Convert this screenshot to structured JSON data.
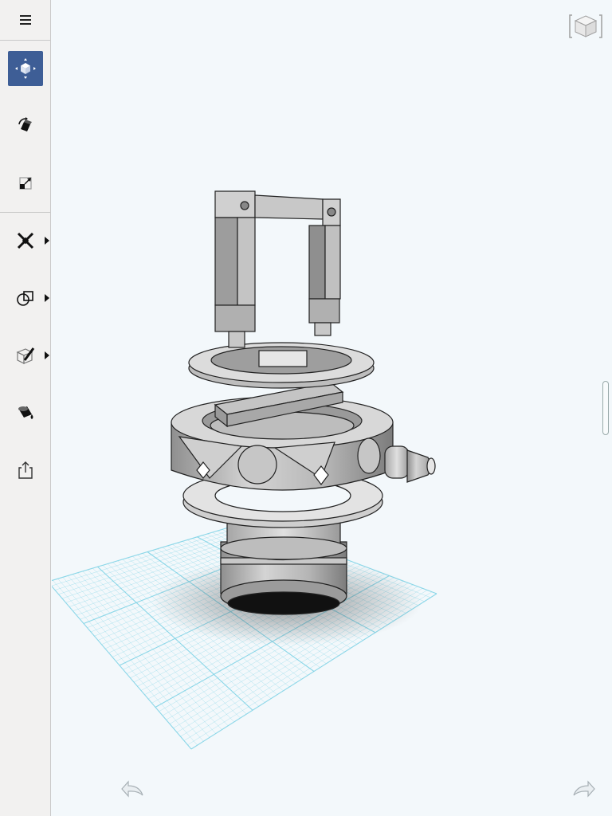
{
  "app": {
    "accent_color": "#3e5e96",
    "grid_color": "#7fd3e6"
  },
  "sidebar": {
    "items": [
      {
        "id": "menu",
        "icon": "hamburger-menu-icon"
      },
      {
        "id": "move",
        "icon": "move-cube-icon",
        "active": true
      },
      {
        "id": "rotate",
        "icon": "rotate-cube-icon"
      },
      {
        "id": "scale",
        "icon": "scale-icon"
      },
      {
        "id": "sketch",
        "icon": "sketch-tools-icon",
        "has_submenu": true
      },
      {
        "id": "primitives",
        "icon": "primitives-shapes-icon",
        "has_submenu": true
      },
      {
        "id": "modify",
        "icon": "modify-pencil-icon",
        "has_submenu": true
      },
      {
        "id": "material",
        "icon": "paint-bucket-icon"
      },
      {
        "id": "export",
        "icon": "share-export-icon"
      }
    ]
  },
  "viewport": {
    "viewcube_icon": "viewcube-icon",
    "undo_icon": "undo-arrow-icon",
    "redo_icon": "redo-arrow-icon"
  }
}
